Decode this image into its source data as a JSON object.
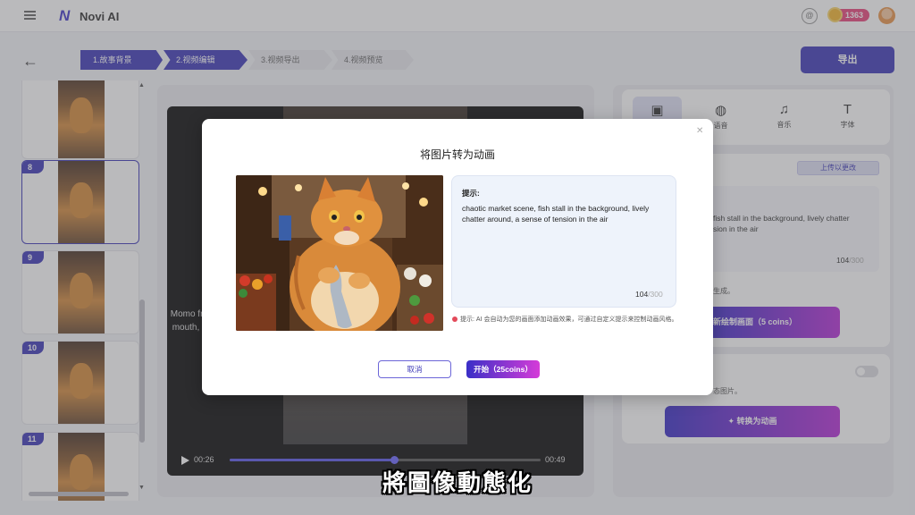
{
  "app": {
    "name": "Novi AI",
    "logo_mark": "N",
    "coins": "1363"
  },
  "steps": [
    {
      "label": "1.故事背景",
      "active": true
    },
    {
      "label": "2.视频编辑",
      "active": true
    },
    {
      "label": "3.视频导出",
      "active": false
    },
    {
      "label": "4.视频预览",
      "active": false
    }
  ],
  "toolbar": {
    "export_label": "导出"
  },
  "scenes": [
    {
      "number": "",
      "selected": false
    },
    {
      "number": "8",
      "selected": true
    },
    {
      "number": "9",
      "selected": false
    },
    {
      "number": "10",
      "selected": false
    },
    {
      "number": "11",
      "selected": false
    }
  ],
  "video": {
    "caption": "Momo froze, fish in mouth, eyes wide.",
    "current_time": "00:26",
    "total_time": "00:49",
    "progress": 0.53
  },
  "right_panel": {
    "tabs": [
      {
        "label": "",
        "icon": "image-icon",
        "active": true
      },
      {
        "label": "语音",
        "icon": "microphone-icon",
        "active": false
      },
      {
        "label": "音乐",
        "icon": "music-icon",
        "active": false
      },
      {
        "label": "字体",
        "icon": "text-icon",
        "active": false
      }
    ],
    "upload_label": "上传以更改",
    "prompt_partial": "fish stall in the background, lively chatter\nsion in the air",
    "count": "104",
    "count_max": "/300",
    "note_generate": "生成。",
    "redraw_label": "新绘制画面（5 coins）",
    "note_image": "态图片。",
    "animate_label": "转换为动画"
  },
  "modal": {
    "title": "将图片转为动画",
    "prompt_label": "提示:",
    "prompt_text": "chaotic market scene, fish stall in the background, lively chatter around, a sense of tension in the air",
    "count": "104",
    "count_max": "/300",
    "hint": "提示: AI 会自动为您的画面添加动画效果，可通过自定义提示来控制动画风格。",
    "cancel_label": "取消",
    "start_label": "开始（25coins）"
  },
  "subtitle": "將圖像動態化",
  "colors": {
    "primary": "#3e3ab8",
    "accent_pink": "#e8467c",
    "gradient_end": "#b72fd8"
  }
}
